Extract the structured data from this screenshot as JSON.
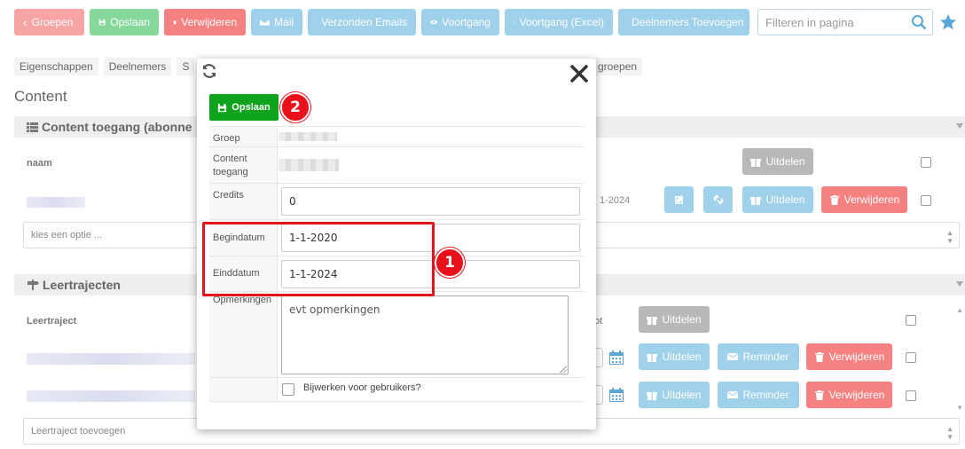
{
  "toolbar": {
    "groups_label": "Groepen",
    "save_label": "Opslaan",
    "delete_label": "Verwijderen",
    "mail_label": "Mail",
    "sent_emails_label": "Verzonden Emails",
    "progress_label": "Voortgang",
    "progress_excel_label": "Voortgang (Excel)",
    "add_participants_label": "Deelnemers Toevoegen",
    "filter_placeholder": "Filteren in pagina"
  },
  "tabs": {
    "properties": "Eigenschappen",
    "participants": "Deelnemers",
    "partial": "S",
    "groups_partial": "groepen"
  },
  "content": {
    "title": "Content",
    "access_panel_title": "Content toegang (abonne",
    "col_name": "naam",
    "row_date": "1-2024",
    "assign_label": "Uitdelen",
    "delete_label": "Verwijderen",
    "select_placeholder": "kies een optie ..."
  },
  "paths": {
    "panel_title": "Leertrajecten",
    "col_path": "Leertraject",
    "col_partial": "ot",
    "assign_label": "Uitdelen",
    "reminder_label": "Reminder",
    "delete_label": "Verwijderen",
    "add_placeholder": "Leertraject toevoegen"
  },
  "modal": {
    "save_label": "Opslaan",
    "badge_1": "1",
    "badge_2": "2",
    "group_label": "Groep",
    "content_access_label": "Content toegang",
    "credits_label": "Credits",
    "credits_value": "0",
    "start_label": "Begindatum",
    "start_value": "1-1-2020",
    "end_label": "Einddatum",
    "end_value": "1-1-2024",
    "remarks_label": "Opmerkingen",
    "remarks_value": "evt opmerkingen",
    "update_users_label": "Bijwerken voor gebruikers?"
  },
  "colors": {
    "save_green": "#10a41e",
    "highlight_red": "#e3141c",
    "button_blue": "#9fd1ea",
    "button_red": "#f58181"
  }
}
